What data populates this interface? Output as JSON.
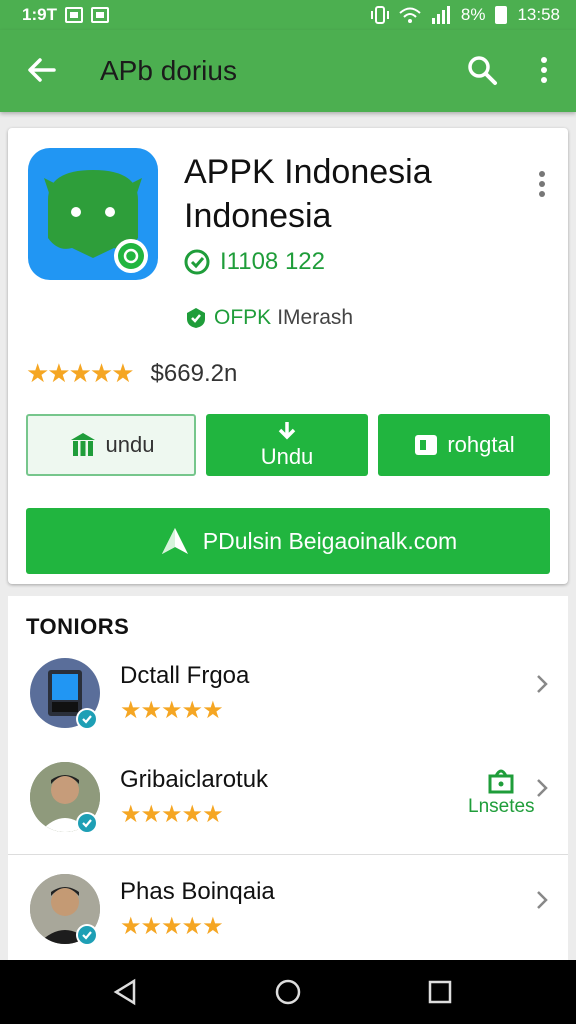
{
  "status": {
    "time": "1:9T",
    "battery": "8%",
    "clock": "13:58"
  },
  "appbar": {
    "title": "APb dorius"
  },
  "app": {
    "name": "APPK Indonesia Indonesia",
    "version": "I1108 122",
    "badge_a": "OFPK",
    "badge_b": "IMerash",
    "rating_stars": "★★★★★",
    "price": "$669.2n"
  },
  "buttons": {
    "secondary_label": "undu",
    "primary_label": "Undu",
    "tertiary_label": "rohgtal",
    "wide_label": "PDulsin  Beigaoinalk.com"
  },
  "section": {
    "title": "TONIORS"
  },
  "items": [
    {
      "name": "Dctall Frgoa",
      "stars": "★★★★★",
      "side": ""
    },
    {
      "name": "Gribaiclarotuk",
      "stars": "★★★★★",
      "side": "Lnsetes"
    },
    {
      "name": "Phas Boinqaia",
      "stars": "★★★★★",
      "side": ""
    }
  ],
  "colors": {
    "brand": "#4caf50",
    "accent": "#21b53f",
    "star": "#f5a623",
    "icon_bg": "#2196f3"
  }
}
